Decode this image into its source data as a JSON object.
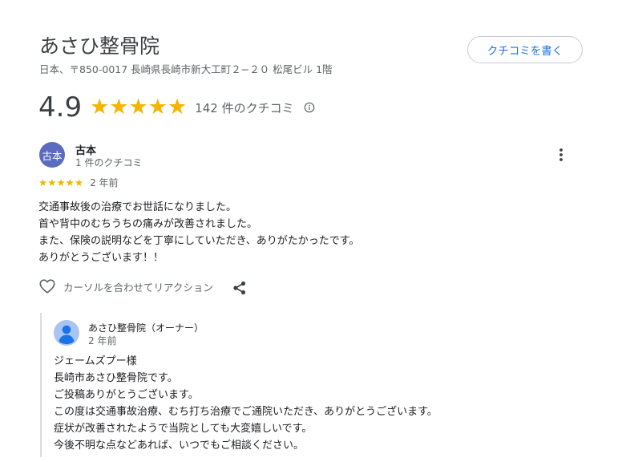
{
  "business": {
    "name": "あさひ整骨院",
    "address": "日本、〒850-0017 長崎県長崎市新大工町２−２０ 松尾ビル 1階",
    "write_review_label": "クチコミを書く",
    "rating": "4.9",
    "review_count": "142 件のクチコミ"
  },
  "review": {
    "avatar_text": "古本",
    "author": "古本",
    "author_reviews": "1 件のクチコミ",
    "rating_stars": 5,
    "date": "2 年前",
    "lines": [
      "交通事故後の治療でお世話になりました。",
      "首や背中のむちうちの痛みが改善されました。",
      "また、保険の説明などを丁寧にしていただき、ありがたかったです。",
      "ありがとうございます！！"
    ],
    "reaction_label": "カーソルを合わせてリアクション"
  },
  "owner_reply": {
    "name": "あさひ整骨院（オーナー）",
    "date": "2 年前",
    "lines": [
      "ジェームズプー様",
      "長崎市あさひ整骨院です。",
      "ご投稿ありがとうございます。",
      "この度は交通事故治療、むち打ち治療でご通院いただき、ありがとうございます。",
      "症状が改善されたようで当院としても大変嬉しいです。",
      "今後不明な点などあれば、いつでもご相談ください。"
    ]
  },
  "colors": {
    "star": "#f4b400",
    "link": "#1a73e8",
    "avatar_review": "#5b6cc0",
    "avatar_owner": "#a8c4f0"
  },
  "icons": [
    "star-icon",
    "info-icon",
    "more-vert-icon",
    "heart-icon",
    "share-icon",
    "person-avatar-icon"
  ]
}
